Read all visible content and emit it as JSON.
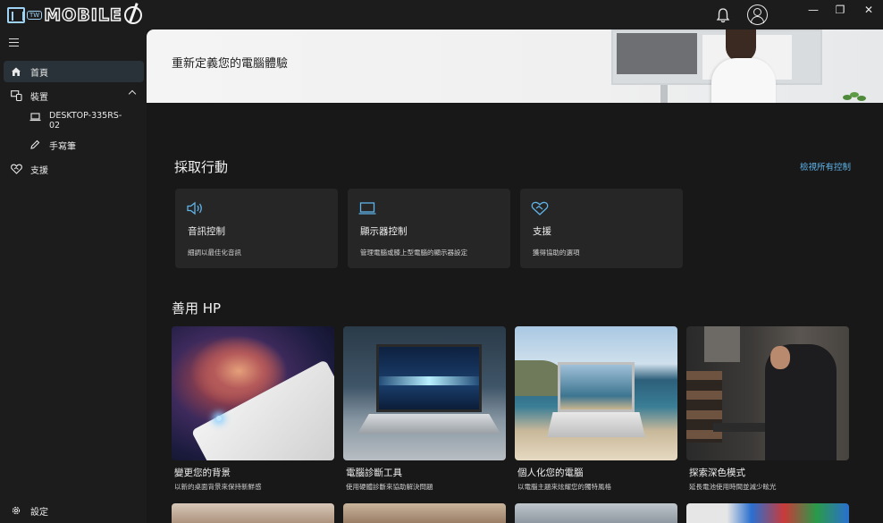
{
  "titlebar": {
    "logo_text": "MOBILE",
    "logo_badge": "TW",
    "minimize": "—",
    "maximize": "❐",
    "close": "✕"
  },
  "sidebar": {
    "items": [
      {
        "label": "首頁",
        "icon": "home-icon"
      },
      {
        "label": "裝置",
        "icon": "devices-icon"
      },
      {
        "label": "DESKTOP-335RS-02",
        "icon": "laptop-icon"
      },
      {
        "label": "手寫筆",
        "icon": "pen-icon"
      },
      {
        "label": "支援",
        "icon": "support-icon"
      }
    ],
    "settings_label": "設定"
  },
  "hero": {
    "title": "重新定義您的電腦體驗"
  },
  "actions": {
    "title": "採取行動",
    "view_all": "檢視所有控制",
    "cards": [
      {
        "title": "音訊控制",
        "desc": "細調以最佳化音訊",
        "icon": "speaker-icon"
      },
      {
        "title": "顯示器控制",
        "desc": "管理電腦或膝上型電腦的顯示器設定",
        "icon": "monitor-icon"
      },
      {
        "title": "支援",
        "desc": "獲得協助的選項",
        "icon": "support-icon"
      }
    ]
  },
  "featured": {
    "title": "善用 HP",
    "cards": [
      {
        "title": "變更您的背景",
        "desc": "以新的桌面背景來保持新鮮感"
      },
      {
        "title": "電腦診斷工具",
        "desc": "使用硬體診斷來協助解決問題"
      },
      {
        "title": "個人化您的電腦",
        "desc": "以電腦主題來炫耀您的獨特風格"
      },
      {
        "title": "探索深色模式",
        "desc": "延長電池使用時間並減少眩光"
      }
    ]
  },
  "colors": {
    "accent": "#5fb4ea",
    "active_nav": "#283238",
    "card_bg": "#262626"
  }
}
